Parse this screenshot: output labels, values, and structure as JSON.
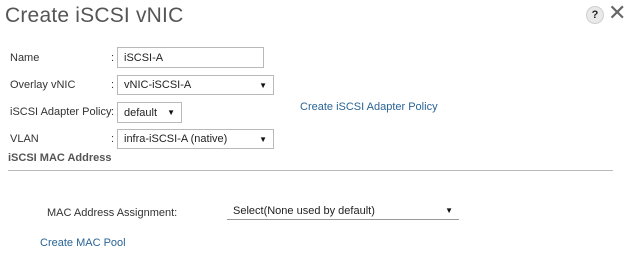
{
  "dialog": {
    "title": "Create iSCSI vNIC",
    "help_icon": "?",
    "close_icon": "✕"
  },
  "form": {
    "name_label": "Name",
    "name_value": "iSCSI-A",
    "overlay_label": "Overlay vNIC",
    "overlay_value": "vNIC-iSCSI-A",
    "adapter_policy_label": "iSCSI Adapter Policy",
    "adapter_policy_value": "default",
    "adapter_policy_link": "Create iSCSI Adapter Policy",
    "vlan_label": "VLAN",
    "vlan_value": "infra-iSCSI-A (native)",
    "colon": ":"
  },
  "mac_section": {
    "header": "iSCSI MAC Address",
    "assignment_label": "MAC Address Assignment:",
    "assignment_value": "Select(None used by default)",
    "create_pool_link": "Create MAC Pool"
  },
  "icons": {
    "dropdown_arrow": "▼"
  }
}
